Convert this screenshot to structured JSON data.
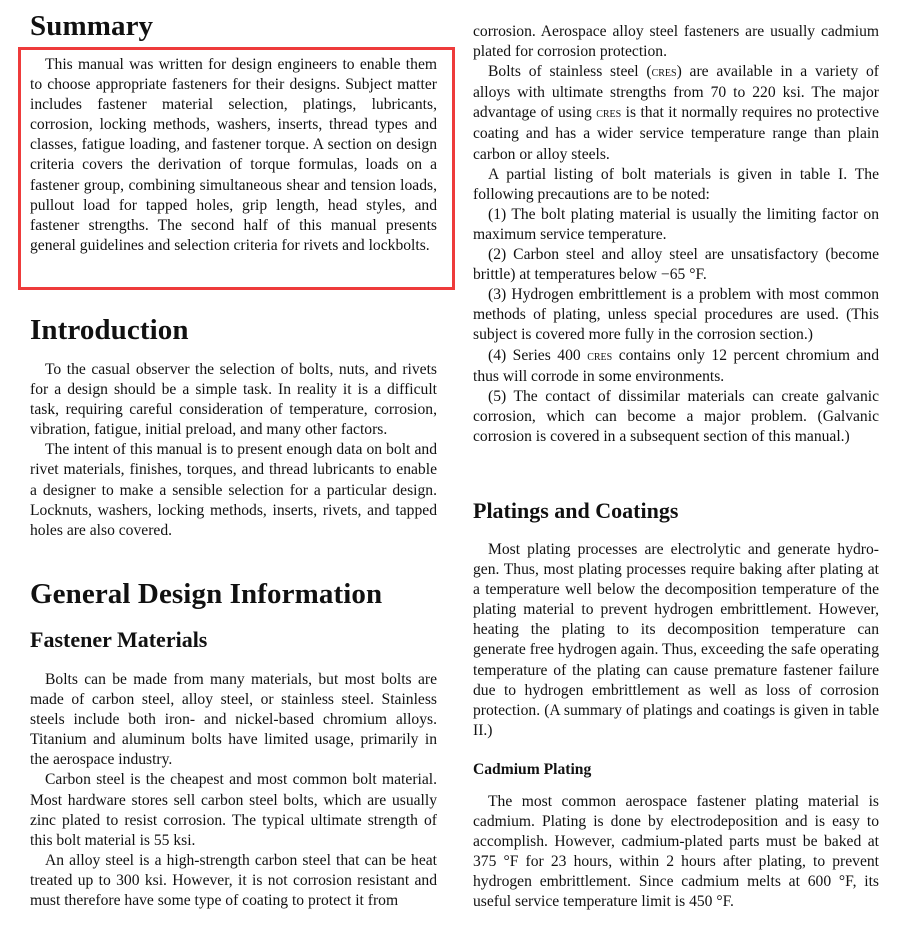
{
  "left_column": {
    "summary": {
      "heading": "Summary",
      "paragraph": "This manual was written for design engineers to enable them to choose appropriate fasteners for their designs. Subject matter includes fastener material selection, platings, lubricants, corrosion, locking methods, washers, inserts, thread types and classes, fatigue loading, and fastener torque. A section on design criteria covers the derivation of torque formulas, loads on a fastener group, combining simultaneous shear and tension loads, pullout load for tapped holes, grip length, head styles, and fastener strengths. The second half of this manual presents general guidelines and selection criteria for rivets and lockbolts.",
      "highlight_color": "#ee3b3b"
    },
    "introduction": {
      "heading": "Introduction",
      "paragraphs": [
        "To the casual observer the selection of bolts, nuts, and rivets for a design should be a simple task. In reality it is a difficult task, requiring careful consideration of temperature, corrosion, vibration, fatigue, initial preload, and many other factors.",
        "The intent of this manual is to present enough data on bolt and rivet materials, finishes, torques, and thread lubricants to enable a designer to make a sensible selection for a particular design. Locknuts, washers, locking methods, inserts, rivets, and tapped holes are also covered."
      ]
    },
    "general_design": {
      "heading": "General Design Information",
      "subheading": "Fastener Materials",
      "paragraphs": [
        "Bolts can be made from many materials, but most bolts are made of carbon steel, alloy steel, or stainless steel. Stainless steels include both iron- and nickel-based chromium alloys. Titanium and aluminum bolts have limited usage, primarily in the aerospace industry.",
        "Carbon steel is the cheapest and most common bolt material. Most hardware stores sell carbon steel bolts, which are usually zinc plated to resist corrosion. The typical ultimate strength of this bolt material is 55 ksi.",
        "An alloy steel is a high-strength carbon steel that can be heat treated up to 300 ksi. However, it is not corrosion resistant and must therefore have some type of coating to protect it from"
      ]
    }
  },
  "right_column": {
    "continuation": "corrosion. Aerospace alloy steel fasteners are usually cadmium plated for corrosion protection.",
    "cres_paragraph": {
      "part1": "Bolts of stainless steel (",
      "abbr1": "cres",
      "part2": ") are available in a variety of alloys with ultimate strengths from 70 to 220 ksi. The major advantage of using ",
      "abbr2": "cres",
      "part3": " is that it normally requires no protective coating and has a wider service temperature range than plain carbon or alloy steels."
    },
    "listing_intro": "A partial listing of bolt materials is given in table I. The following precautions are to be noted:",
    "precautions": [
      {
        "text": "(1) The bolt plating material is usually the limiting factor on maximum service temperature."
      },
      {
        "text": "(2) Carbon steel and alloy steel are unsatisfactory (become brittle) at temperatures below −65 °F."
      },
      {
        "text": "(3) Hydrogen embrittlement is a problem with most common methods of plating, unless special procedures are used. (This subject is covered more fully in the corrosion section.)"
      },
      {
        "part1": "(4) Series 400 ",
        "abbr": "cres",
        "part2": " contains only 12 percent chromium and thus will corrode in some environments."
      },
      {
        "text": "(5) The contact of dissimilar materials can create galvanic corrosion, which can become a major problem. (Galvanic corrosion is covered in a subsequent section of this manual.)"
      }
    ],
    "platings": {
      "heading": "Platings and Coatings",
      "paragraph": "Most plating processes are electrolytic and generate hydro-gen. Thus, most plating processes require baking after plating at a temperature well below the decomposition temperature of the plating material to prevent hydrogen embrittlement. However, heating the plating to its decomposition temperature can generate free hydrogen again. Thus, exceeding the safe operating temperature of the plating can cause premature fastener failure due to hydrogen embrittlement as well as loss of corrosion protection. (A summary of platings and coatings is given in table II.)"
    },
    "cadmium": {
      "heading": "Cadmium Plating",
      "paragraph": "The most common aerospace fastener plating material is cadmium. Plating is done by electrodeposition and is easy to accomplish. However, cadmium-plated parts must be baked at 375 °F for 23 hours, within 2 hours after plating, to prevent hydrogen embrittlement. Since cadmium melts at 600 °F, its useful service temperature limit is 450 °F."
    }
  }
}
